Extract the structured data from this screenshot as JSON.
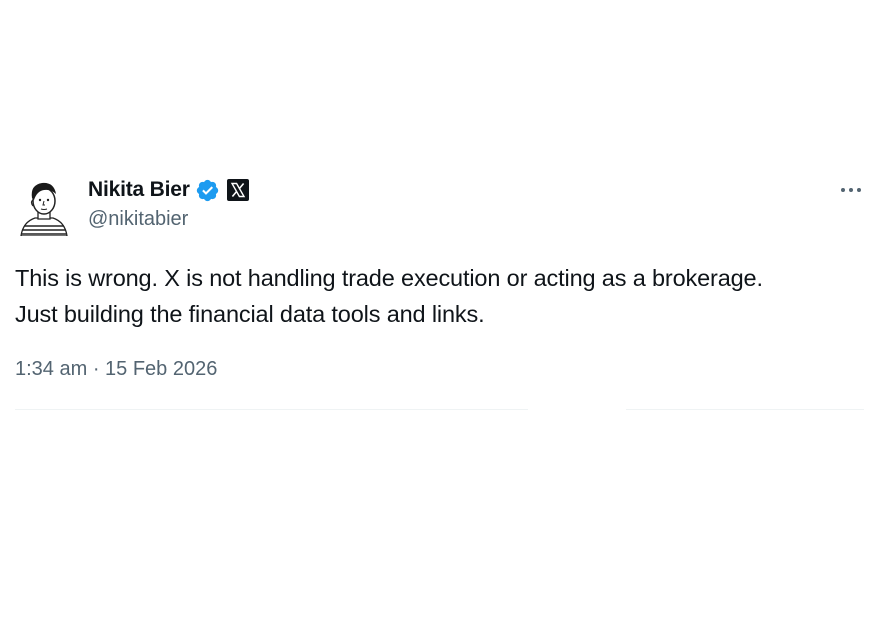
{
  "author": {
    "display_name": "Nikita Bier",
    "handle": "@nikitabier",
    "verified_icon": "verified-badge-icon",
    "affiliate_icon": "x-logo-icon"
  },
  "tweet": {
    "text_lines": [
      "This is wrong. X is not handling trade execution or acting as a brokerage.",
      "Just building the financial data tools and links."
    ],
    "timestamp": "1:34 am · 15 Feb 2026"
  },
  "actions": {
    "more_icon": "more-options-icon"
  },
  "colors": {
    "text": "#0f1419",
    "secondary_text": "#536471",
    "verified_blue": "#1d9bf0",
    "divider": "#eff3f4"
  }
}
